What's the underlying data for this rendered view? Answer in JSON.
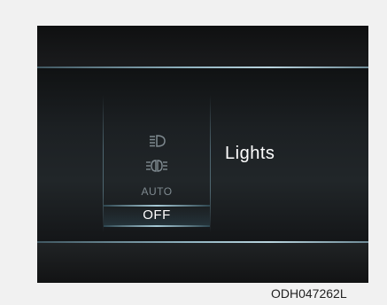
{
  "lights_menu": {
    "options": [
      {
        "icon": "headlight-icon",
        "label": ""
      },
      {
        "icon": "parking-light-icon",
        "label": ""
      },
      {
        "icon": "",
        "label": "AUTO"
      },
      {
        "icon": "",
        "label": "OFF"
      }
    ],
    "selected_label": "OFF",
    "title": "Lights"
  },
  "caption": "ODH047262L",
  "colors": {
    "screen_bg": "#141516",
    "accent_line": "#9fc0cc",
    "selected_text": "#ffffff",
    "inactive_text": "#7f8a90"
  }
}
